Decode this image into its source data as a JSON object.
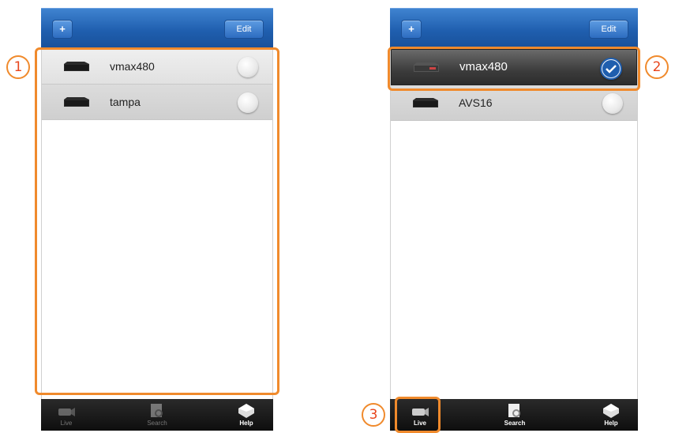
{
  "annotations": {
    "one": "1",
    "two": "2",
    "three": "3"
  },
  "left_screen": {
    "add_label": "+",
    "edit_label": "Edit",
    "devices": [
      {
        "name": "vmax480",
        "selected": false
      },
      {
        "name": "tampa",
        "selected": false
      }
    ],
    "tabs": [
      {
        "label": "Live",
        "icon": "camera-icon",
        "active": false
      },
      {
        "label": "Search",
        "icon": "search-icon",
        "active": false
      },
      {
        "label": "Help",
        "icon": "help-icon",
        "active": true
      }
    ]
  },
  "right_screen": {
    "add_label": "+",
    "edit_label": "Edit",
    "devices": [
      {
        "name": "vmax480",
        "selected": true
      },
      {
        "name": "AVS16",
        "selected": false
      }
    ],
    "tabs": [
      {
        "label": "Live",
        "icon": "camera-icon",
        "active": true
      },
      {
        "label": "Search",
        "icon": "search-icon",
        "active": true
      },
      {
        "label": "Help",
        "icon": "help-icon",
        "active": true
      }
    ]
  },
  "colors": {
    "accent_blue": "#1f5eae",
    "highlight": "#f08a2c",
    "badge_text": "#e8451c"
  }
}
